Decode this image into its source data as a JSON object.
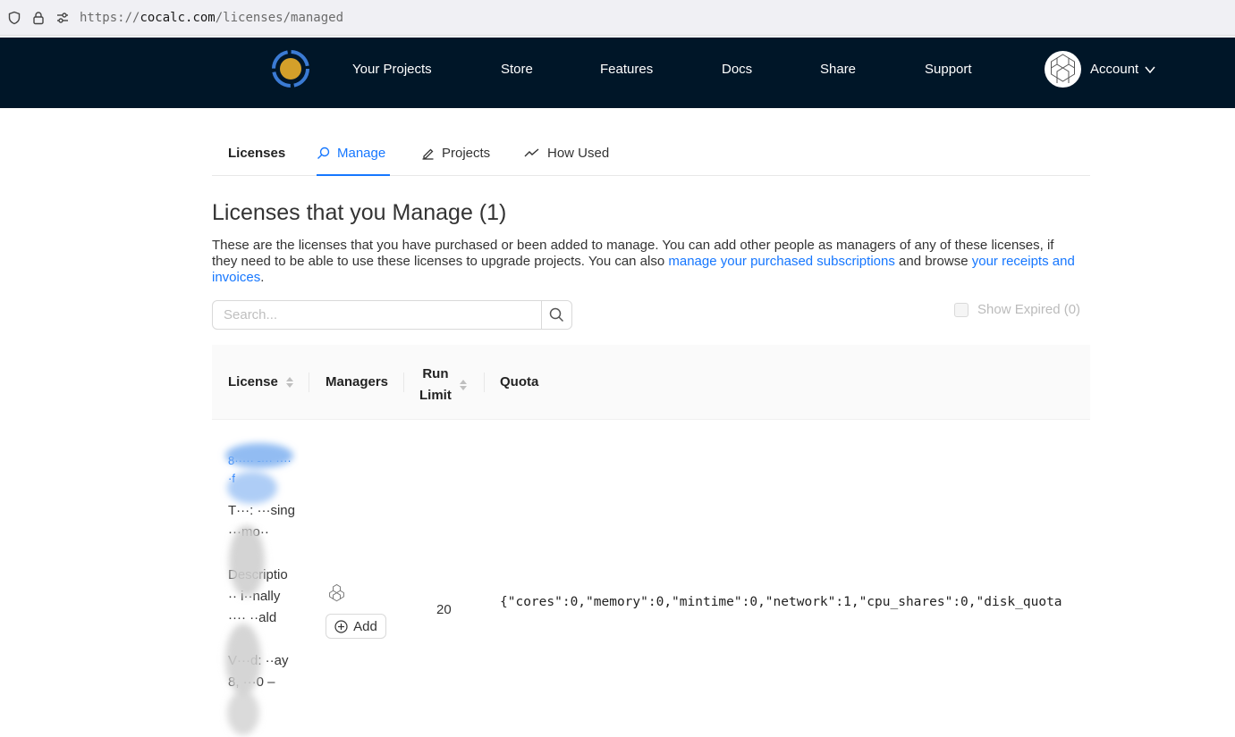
{
  "browser": {
    "url_scheme": "https://",
    "url_host": "cocalc.com",
    "url_path": "/licenses/managed",
    "shield_icon": "shield-icon",
    "lock_icon": "lock-icon",
    "tune_icon": "permissions-icon"
  },
  "topnav": {
    "items": [
      "Your Projects",
      "Store",
      "Features",
      "Docs",
      "Share",
      "Support"
    ],
    "account_label": "Account",
    "colors": {
      "background": "#001628",
      "logo_ring": "#3b7bd4",
      "logo_center": "#d4a02a"
    }
  },
  "tabs": {
    "licenses": "Licenses",
    "manage": "Manage",
    "projects": "Projects",
    "how_used": "How Used",
    "active": "Manage",
    "accent": "#1677ff"
  },
  "page": {
    "title": "Licenses that you Manage (1)",
    "desc_text_1": "These are the licenses that you have purchased or been added to manage. You can add other people as managers of any of these licenses, if they need to be able to use these licenses to upgrade projects. You can also ",
    "desc_link_1": "manage your purchased subscriptions",
    "desc_text_2": " and browse ",
    "desc_link_2": "your receipts and invoices",
    "desc_text_3": "."
  },
  "search": {
    "placeholder": "Search...",
    "value": ""
  },
  "show_expired": {
    "label": "Show Expired (0)",
    "checked": false,
    "disabled": true
  },
  "table": {
    "headers": {
      "license": "License",
      "managers": "Managers",
      "run_limit_1": "Run",
      "run_limit_2": "Limit",
      "quota": "Quota"
    },
    "rows": [
      {
        "license_id": "8····· -··· ·····f",
        "type_label": "T···: ···sing ···mo··",
        "description_label": "Descriptio ·· i··nally ···· ··ald",
        "valid_label": "V···d: ··ay 8, ···0 –",
        "add_label": "Add",
        "run_limit": "20",
        "quota": "{\"cores\":0,\"memory\":0,\"mintime\":0,\"network\":1,\"cpu_shares\":0,\"disk_quota"
      }
    ]
  }
}
